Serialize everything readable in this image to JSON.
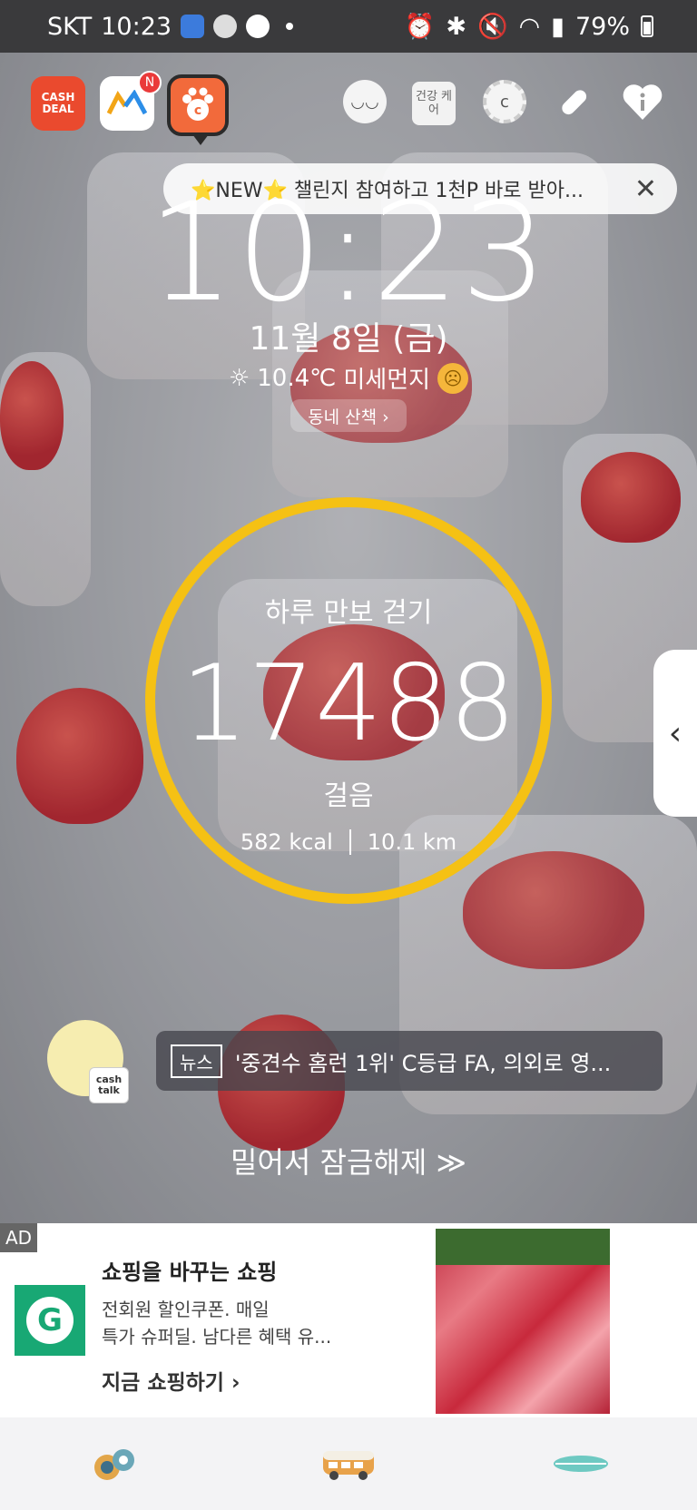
{
  "status_bar": {
    "carrier": "SKT",
    "time": "10:23",
    "battery": "79%"
  },
  "top_bar": {
    "cashdeal_label": "CASH DEAL",
    "trend_badge": "N",
    "health_label": "건강 케어"
  },
  "notice": {
    "text": "⭐NEW⭐ 챌린지 참여하고 1천P 바로 받아..."
  },
  "lock": {
    "clock": "10:23",
    "date": "11월 8일 (금)",
    "temperature": "10.4℃",
    "dust_label": "미세먼지",
    "walk_button": "동네 산책 ›"
  },
  "steps": {
    "title": "하루 만보 걷기",
    "count": "17488",
    "unit": "걸음",
    "kcal": "582 kcal",
    "distance": "10.1 km"
  },
  "news": {
    "avatar_tag": "cash talk",
    "label": "뉴스",
    "headline": "'중견수 홈런 1위' C등급 FA, 의외로 영..."
  },
  "unlock_text": "밀어서 잠금해제 ≫",
  "ad": {
    "tag": "AD",
    "title": "쇼핑을 바꾸는 쇼핑",
    "desc_line1": "전회원 할인쿠폰. 매일",
    "desc_line2": "특가 슈퍼딜. 남다른 혜택 유...",
    "cta": "지금 쇼핑하기 ›"
  },
  "colors": {
    "ring": "#f5c114",
    "status_bg": "#3a3a3c",
    "ad_logo": "#18a874"
  }
}
